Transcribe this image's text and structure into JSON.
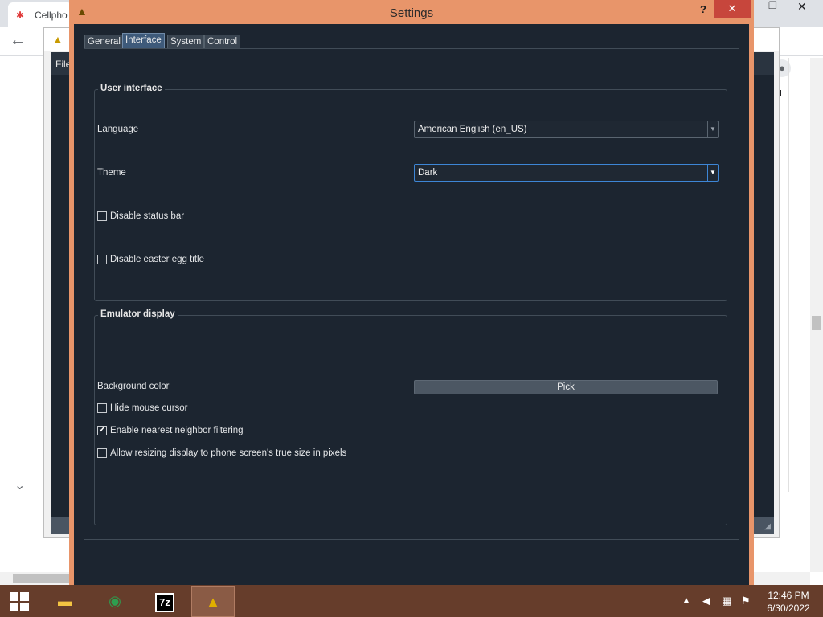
{
  "browser": {
    "tab_title": "Cellpho",
    "bg_menu_file": "File"
  },
  "settings": {
    "title": "Settings",
    "help_label": "?",
    "close_label": "✕",
    "tabs": [
      {
        "label": "General",
        "active": false
      },
      {
        "label": "Interface",
        "active": true
      },
      {
        "label": "System",
        "active": false
      },
      {
        "label": "Control",
        "active": false
      }
    ],
    "user_interface": {
      "title": "User interface",
      "language_label": "Language",
      "language_value": "American English (en_US)",
      "theme_label": "Theme",
      "theme_value": "Dark",
      "disable_status_bar": {
        "label": "Disable status bar",
        "checked": false
      },
      "disable_easter_egg_title": {
        "label": "Disable easter egg title",
        "checked": false
      }
    },
    "emulator_display": {
      "title": "Emulator display",
      "background_color_label": "Background color",
      "pick_label": "Pick",
      "hide_mouse_cursor": {
        "label": "Hide mouse cursor",
        "checked": false
      },
      "nearest_neighbor": {
        "label": "Enable nearest neighbor filtering",
        "checked": true
      },
      "allow_resizing": {
        "label": "Allow resizing display to phone screen's true size in pixels",
        "checked": false
      }
    }
  },
  "taskbar": {
    "items": [
      "file-explorer",
      "chrome",
      "7-zip",
      "emulator"
    ],
    "sevenz_label": "7z",
    "time": "12:46 PM",
    "date": "6/30/2022"
  },
  "colors": {
    "dialog_frame": "#e8956a",
    "dialog_body": "#1c2530",
    "close_button": "#c7463c",
    "taskbar": "#663d2b",
    "accent_focus": "#3d86d6"
  }
}
